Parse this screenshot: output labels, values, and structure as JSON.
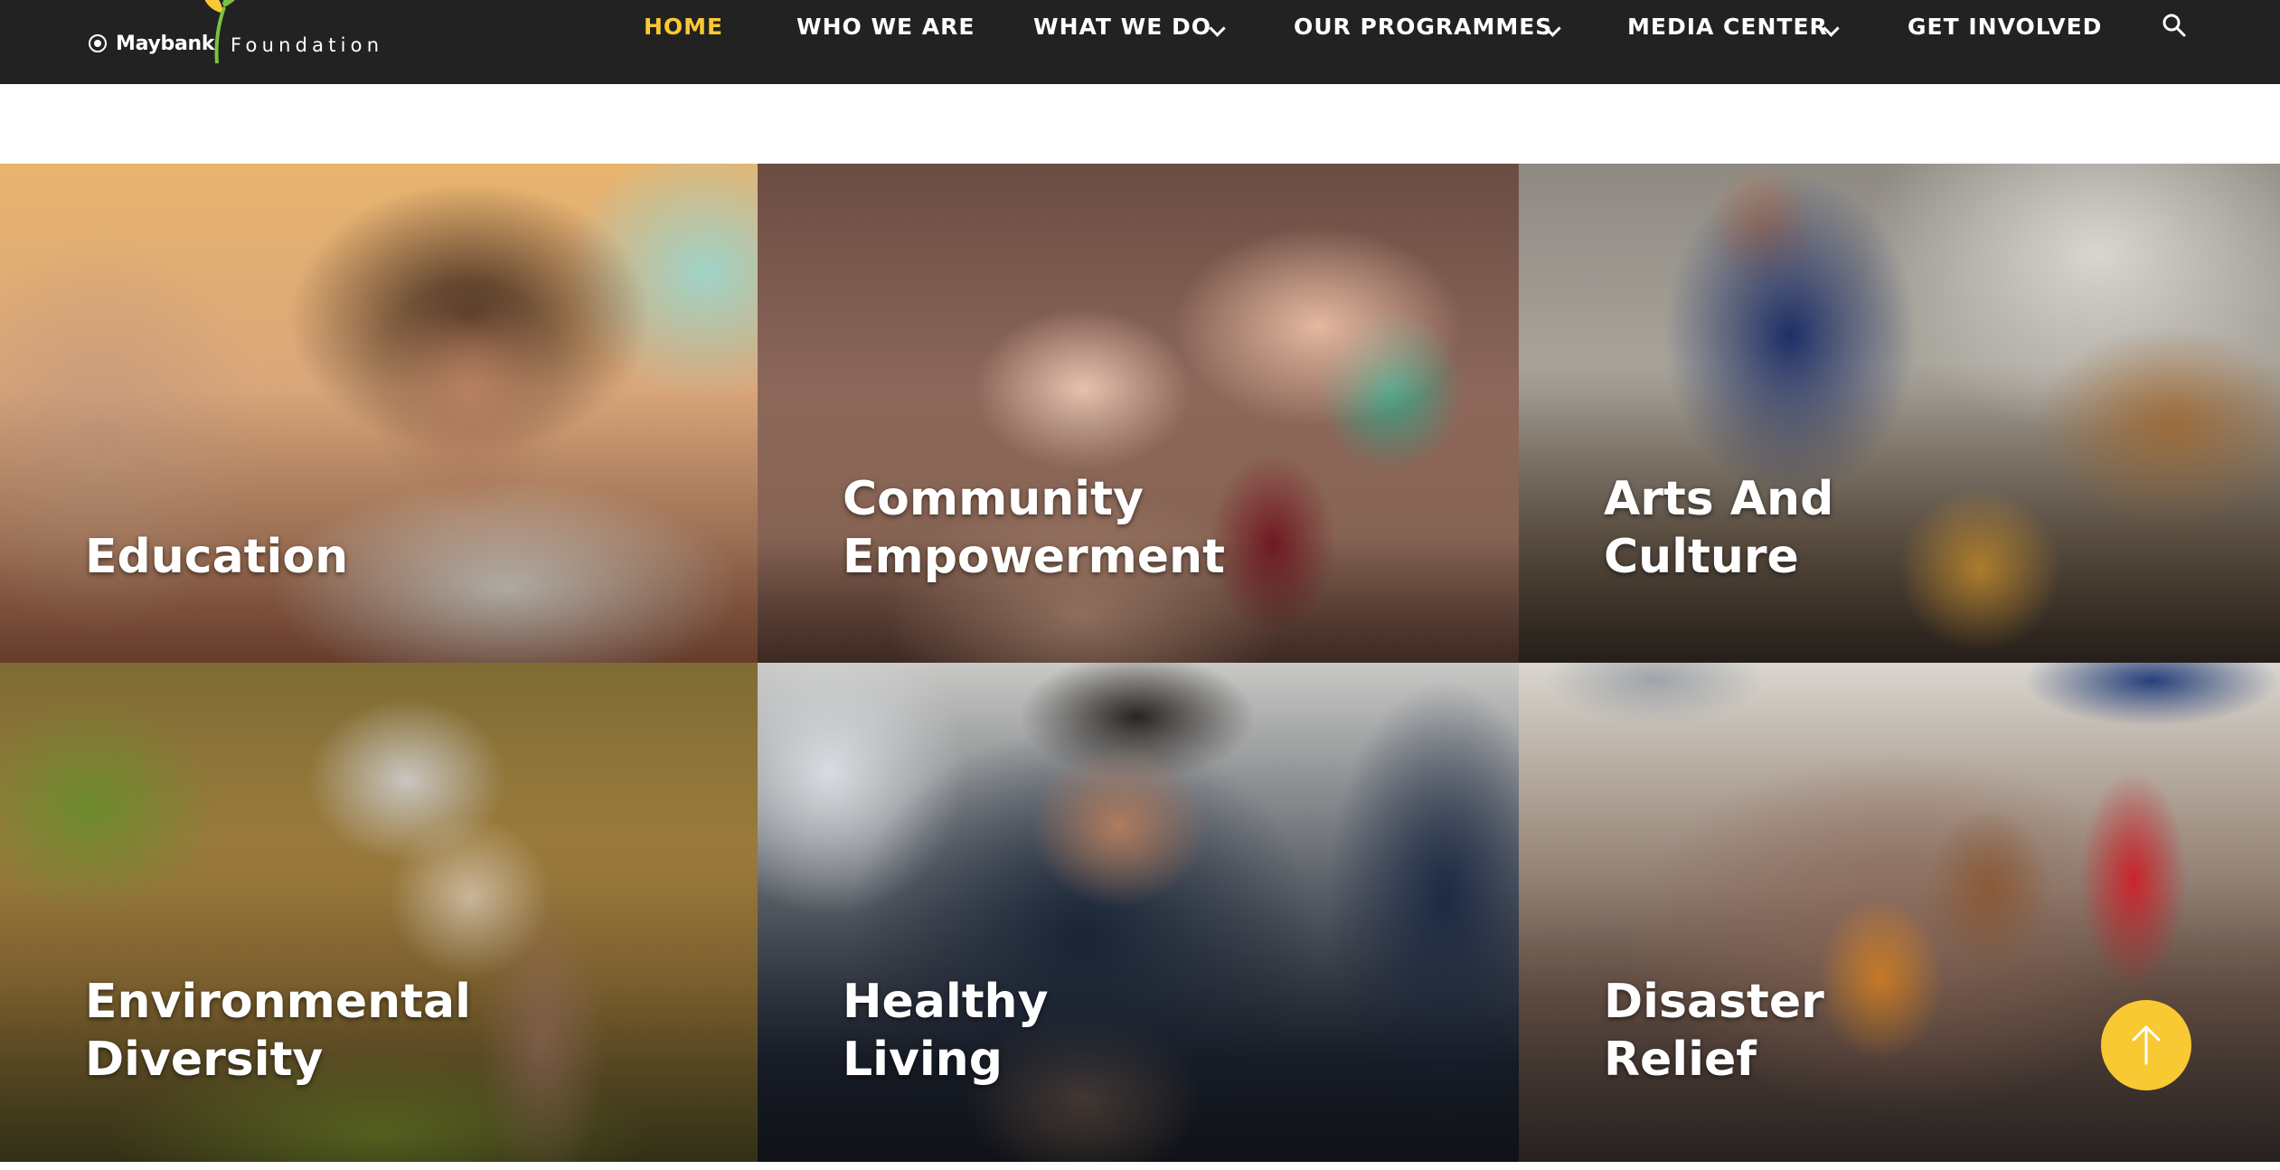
{
  "brand": {
    "name": "Maybank",
    "suffix": "Foundation",
    "accent": "#f9c933",
    "header_bg": "#222222"
  },
  "nav": {
    "items": [
      {
        "label": "HOME",
        "active": true,
        "has_dropdown": false
      },
      {
        "label": "WHO WE ARE",
        "active": false,
        "has_dropdown": false
      },
      {
        "label": "WHAT WE DO",
        "active": false,
        "has_dropdown": true
      },
      {
        "label": "OUR PROGRAMMES",
        "active": false,
        "has_dropdown": true
      },
      {
        "label": "MEDIA CENTER",
        "active": false,
        "has_dropdown": true
      },
      {
        "label": "GET INVOLVED",
        "active": false,
        "has_dropdown": false
      }
    ],
    "search_icon": "search-icon",
    "dropdown_icon": "chevron-down-icon"
  },
  "tiles": [
    {
      "title": "Education",
      "photo": "smiling girl writing in classroom"
    },
    {
      "title": "Community\nEmpowerment",
      "photo": "stacked hands with bracelets"
    },
    {
      "title": "Arts And\nCulture",
      "photo": "elderly craftsman weaving"
    },
    {
      "title": "Environmental\nDiversity",
      "photo": "farmer planting rice"
    },
    {
      "title": "Healthy\nLiving",
      "photo": "nurse with baby"
    },
    {
      "title": "Disaster\nRelief",
      "photo": "families at relief camp"
    }
  ],
  "scroll_top": {
    "icon": "arrow-up-icon"
  }
}
